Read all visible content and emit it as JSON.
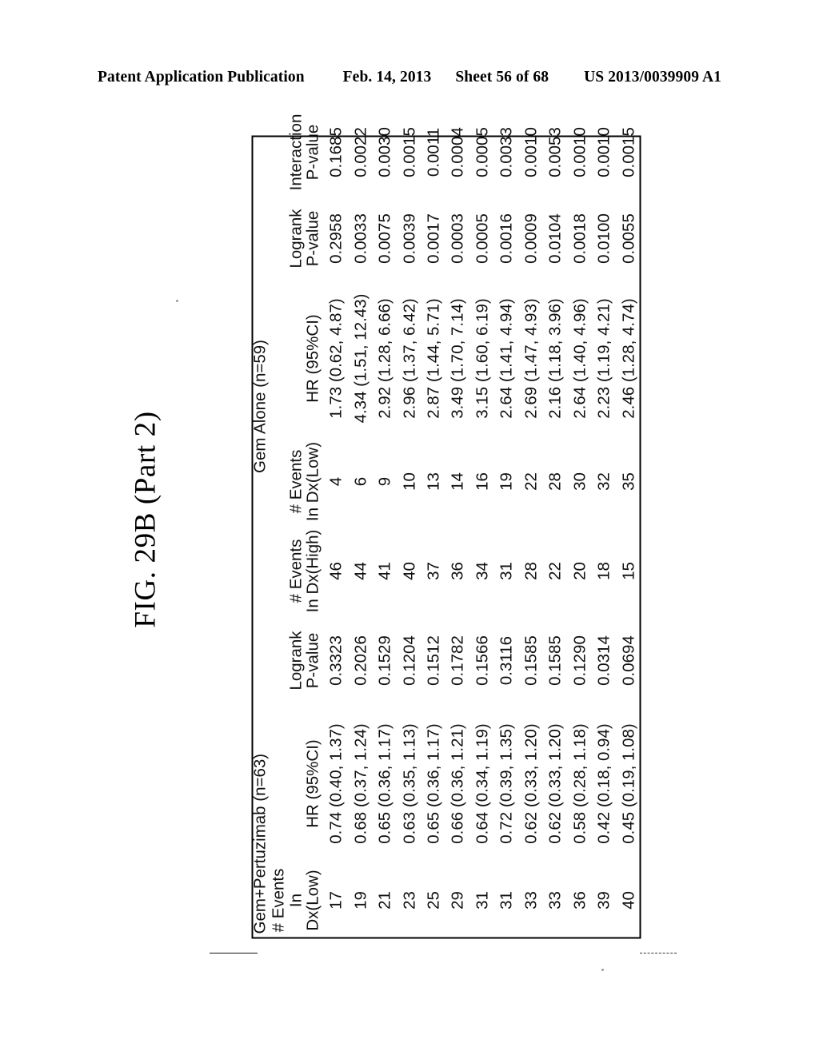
{
  "page_header": {
    "publication": "Patent Application Publication",
    "date": "Feb. 14, 2013",
    "sheet": "Sheet 56 of 68",
    "patent_number": "US 2013/0039909 A1"
  },
  "figure": {
    "caption": "FIG. 29B (Part 2)"
  },
  "table": {
    "group_headers": {
      "left": "Gem+Pertuzimab (n=63)",
      "right": "Gem Alone (n=59)"
    },
    "columns": [
      {
        "line1": "# Events",
        "line2": "In Dx(Low)"
      },
      {
        "line1": "HR (95%CI)",
        "line2": ""
      },
      {
        "line1": "Logrank",
        "line2": "P-value"
      },
      {
        "line1": "# Events",
        "line2": "In Dx(High)"
      },
      {
        "line1": "# Events",
        "line2": "In Dx(Low)"
      },
      {
        "line1": "HR (95%CI)",
        "line2": ""
      },
      {
        "line1": "Logrank",
        "line2": "P-value"
      },
      {
        "line1": "Interaction",
        "line2": "P-value"
      }
    ],
    "rows": [
      {
        "gp_events_low": "17",
        "gp_hr": "0.74 (0.40, 1.37)",
        "gp_logrank": "0.3323",
        "ga_events_high": "46",
        "ga_events_low": "4",
        "ga_hr": "1.73 (0.62, 4.87)",
        "ga_logrank": "0.2958",
        "interaction": "0.1685"
      },
      {
        "gp_events_low": "19",
        "gp_hr": "0.68 (0.37, 1.24)",
        "gp_logrank": "0.2026",
        "ga_events_high": "44",
        "ga_events_low": "6",
        "ga_hr": "4.34 (1.51, 12.43)",
        "ga_logrank": "0.0033",
        "interaction": "0.0022"
      },
      {
        "gp_events_low": "21",
        "gp_hr": "0.65 (0.36, 1.17)",
        "gp_logrank": "0.1529",
        "ga_events_high": "41",
        "ga_events_low": "9",
        "ga_hr": "2.92 (1.28, 6.66)",
        "ga_logrank": "0.0075",
        "interaction": "0.0030"
      },
      {
        "gp_events_low": "23",
        "gp_hr": "0.63 (0.35, 1.13)",
        "gp_logrank": "0.1204",
        "ga_events_high": "40",
        "ga_events_low": "10",
        "ga_hr": "2.96 (1.37, 6.42)",
        "ga_logrank": "0.0039",
        "interaction": "0.0015"
      },
      {
        "gp_events_low": "25",
        "gp_hr": "0.65 (0.36, 1.17)",
        "gp_logrank": "0.1512",
        "ga_events_high": "37",
        "ga_events_low": "13",
        "ga_hr": "2.87 (1.44, 5.71)",
        "ga_logrank": "0.0017",
        "interaction": "0.0011"
      },
      {
        "gp_events_low": "29",
        "gp_hr": "0.66 (0.36, 1.21)",
        "gp_logrank": "0.1782",
        "ga_events_high": "36",
        "ga_events_low": "14",
        "ga_hr": "3.49 (1.70, 7.14)",
        "ga_logrank": "0.0003",
        "interaction": "0.0004"
      },
      {
        "gp_events_low": "31",
        "gp_hr": "0.64 (0.34, 1.19)",
        "gp_logrank": "0.1566",
        "ga_events_high": "34",
        "ga_events_low": "16",
        "ga_hr": "3.15 (1.60, 6.19)",
        "ga_logrank": "0.0005",
        "interaction": "0.0005"
      },
      {
        "gp_events_low": "31",
        "gp_hr": "0.72 (0.39, 1.35)",
        "gp_logrank": "0.3116",
        "ga_events_high": "31",
        "ga_events_low": "19",
        "ga_hr": "2.64 (1.41, 4.94)",
        "ga_logrank": "0.0016",
        "interaction": "0.0033"
      },
      {
        "gp_events_low": "33",
        "gp_hr": "0.62 (0.33, 1.20)",
        "gp_logrank": "0.1585",
        "ga_events_high": "28",
        "ga_events_low": "22",
        "ga_hr": "2.69 (1.47, 4.93)",
        "ga_logrank": "0.0009",
        "interaction": "0.0010"
      },
      {
        "gp_events_low": "33",
        "gp_hr": "0.62 (0.33, 1.20)",
        "gp_logrank": "0.1585",
        "ga_events_high": "22",
        "ga_events_low": "28",
        "ga_hr": "2.16 (1.18, 3.96)",
        "ga_logrank": "0.0104",
        "interaction": "0.0053"
      },
      {
        "gp_events_low": "36",
        "gp_hr": "0.58 (0.28, 1.18)",
        "gp_logrank": "0.1290",
        "ga_events_high": "20",
        "ga_events_low": "30",
        "ga_hr": "2.64 (1.40, 4.96)",
        "ga_logrank": "0.0018",
        "interaction": "0.0010"
      },
      {
        "gp_events_low": "39",
        "gp_hr": "0.42 (0.18, 0.94)",
        "gp_logrank": "0.0314",
        "ga_events_high": "18",
        "ga_events_low": "32",
        "ga_hr": "2.23 (1.19, 4.21)",
        "ga_logrank": "0.0100",
        "interaction": "0.0010"
      },
      {
        "gp_events_low": "40",
        "gp_hr": "0.45 (0.19, 1.08)",
        "gp_logrank": "0.0694",
        "ga_events_high": "15",
        "ga_events_low": "35",
        "ga_hr": "2.46 (1.28, 4.74)",
        "ga_logrank": "0.0055",
        "interaction": "0.0015"
      }
    ]
  }
}
